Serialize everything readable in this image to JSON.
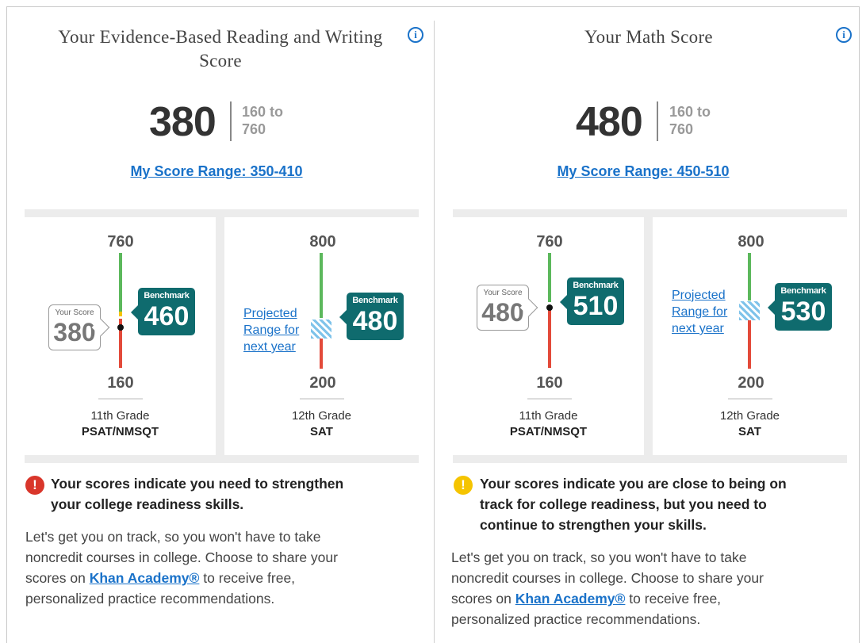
{
  "left_panel": {
    "title": "Your Evidence-Based Reading and Writing Score",
    "score": "380",
    "range_low": "160 to",
    "range_high": "760",
    "score_range_link": "My Score Range: 350-410",
    "psat": {
      "top": "760",
      "bottom": "160",
      "your_score_label": "Your Score",
      "your_score": "380",
      "benchmark_label": "Benchmark",
      "benchmark": "460",
      "grade": "11th Grade",
      "exam": "PSAT/NMSQT"
    },
    "sat": {
      "top": "800",
      "bottom": "200",
      "projected_line1": "Projected",
      "projected_line2": "Range for",
      "projected_line3": "next year",
      "benchmark_label": "Benchmark",
      "benchmark": "480",
      "grade": "12th Grade",
      "exam": "SAT"
    },
    "alert_line1": "Your scores indicate you need to strengthen",
    "alert_line2": "your college readiness skills.",
    "para_line1": "Let's get you on track, so you won't have to take",
    "para_line2": "noncredit courses in college. Choose to share your",
    "para_line3_pre": "scores on ",
    "para_link": "Khan Academy®",
    "para_line3_post": " to receive free,",
    "para_line4": "personalized practice recommendations."
  },
  "right_panel": {
    "title": "Your Math Score",
    "score": "480",
    "range_low": "160 to",
    "range_high": "760",
    "score_range_link": "My Score Range: 450-510",
    "psat": {
      "top": "760",
      "bottom": "160",
      "your_score_label": "Your Score",
      "your_score": "480",
      "benchmark_label": "Benchmark",
      "benchmark": "510",
      "grade": "11th Grade",
      "exam": "PSAT/NMSQT"
    },
    "sat": {
      "top": "800",
      "bottom": "200",
      "projected_line1": "Projected",
      "projected_line2": "Range for",
      "projected_line3": "next year",
      "benchmark_label": "Benchmark",
      "benchmark": "530",
      "grade": "12th Grade",
      "exam": "SAT"
    },
    "alert_line1": "Your scores indicate you are close to being on",
    "alert_line2": "track for college readiness, but you need to",
    "alert_line3": "continue to strengthen your skills.",
    "para_line1": "Let's get you on track, so you won't have to take",
    "para_line2": "noncredit courses in college. Choose to share your",
    "para_line3_pre": "scores on ",
    "para_link": "Khan Academy®",
    "para_line3_post": " to receive free,",
    "para_line4": "personalized practice recommendations."
  },
  "icons": {
    "info": "i",
    "alert": "!"
  },
  "colors": {
    "benchmark": "#0f6b6e",
    "above": "#5cb85c",
    "below": "#e34a3a",
    "link": "#1a72c9"
  }
}
